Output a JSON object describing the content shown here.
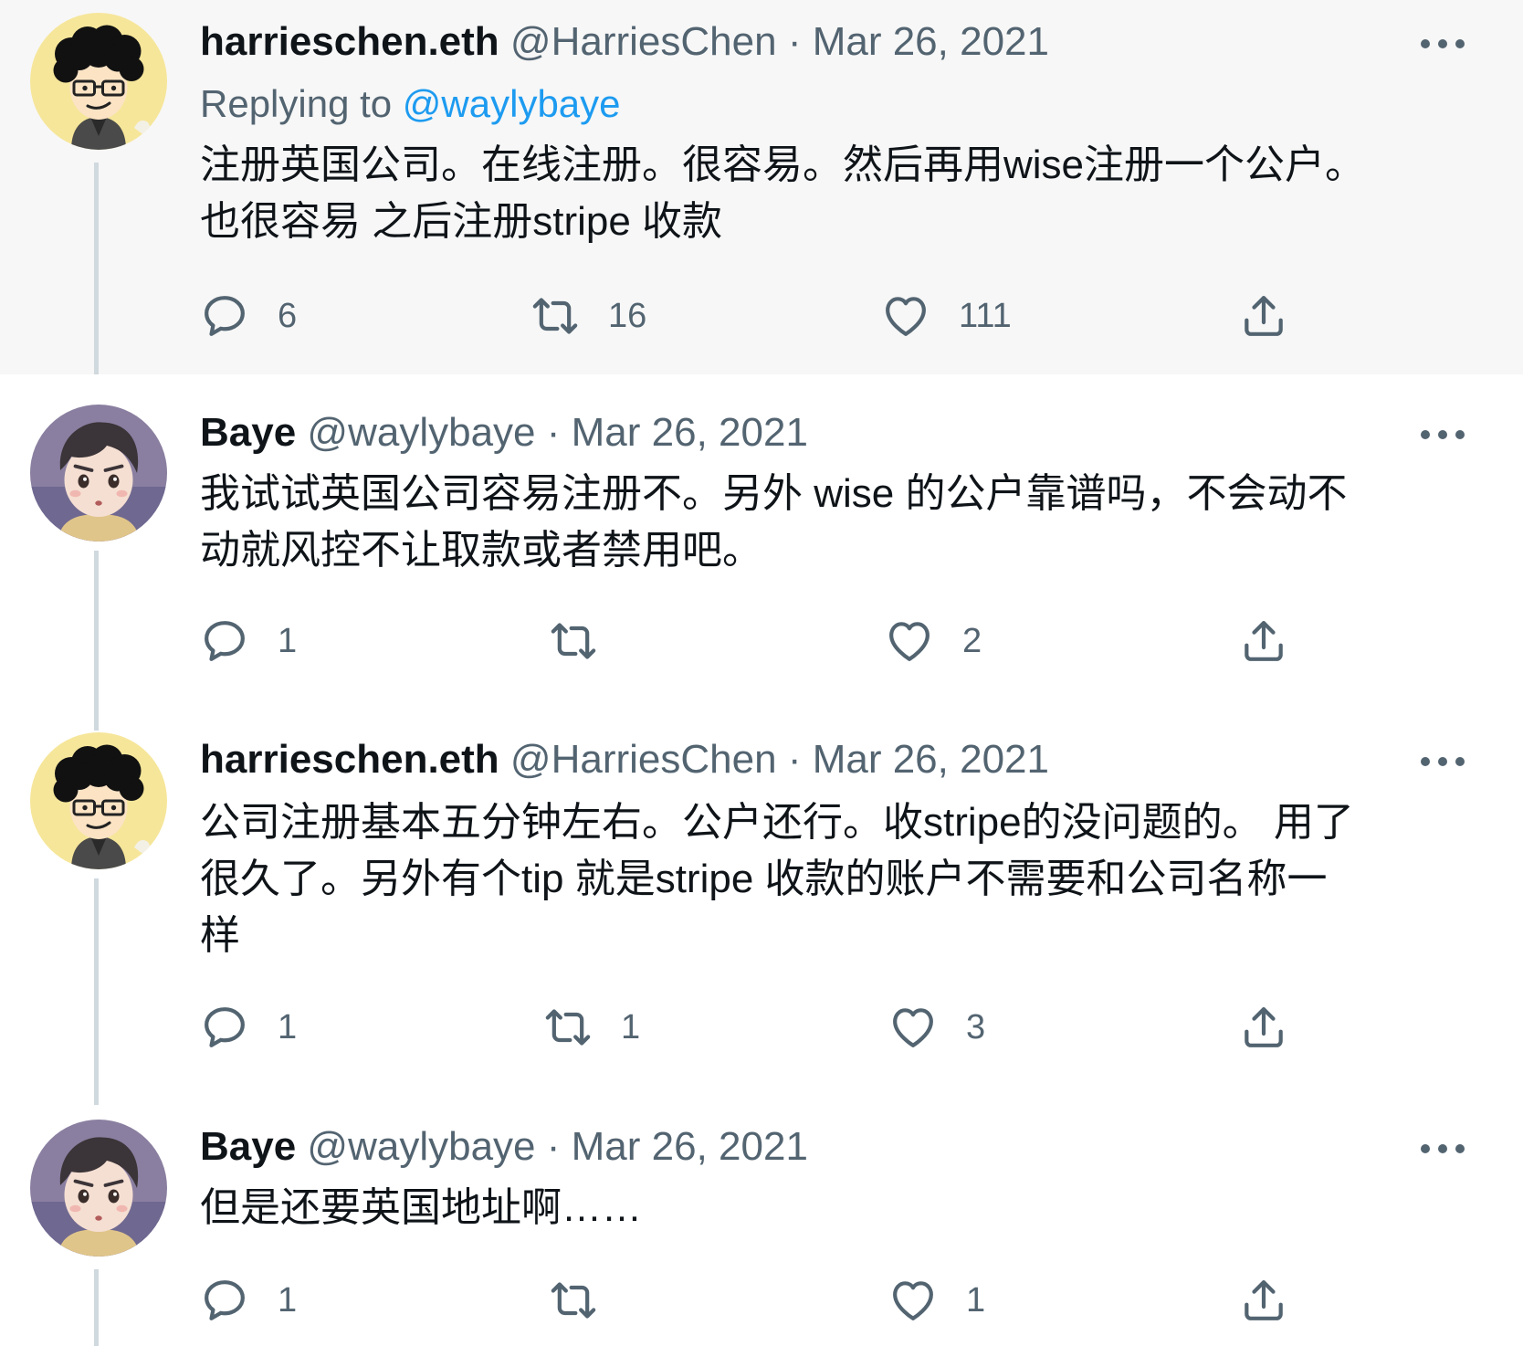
{
  "tweets": [
    {
      "display_name": "harrieschen.eth",
      "handle": "@HarriesChen",
      "separator": "·",
      "date": "Mar 26, 2021",
      "replying_label": "Replying to",
      "replying_to": "@waylybaye",
      "text": "注册英国公司。在线注册。很容易。然后再用wise注册一个公户。\n也很容易 之后注册stripe 收款",
      "reply_count": "6",
      "retweet_count": "16",
      "like_count": "111"
    },
    {
      "display_name": "Baye",
      "handle": "@waylybaye",
      "separator": "·",
      "date": "Mar 26, 2021",
      "text": "我试试英国公司容易注册不。另外 wise 的公户靠谱吗，不会动不\n动就风控不让取款或者禁用吧。",
      "reply_count": "1",
      "retweet_count": "",
      "like_count": "2"
    },
    {
      "display_name": "harrieschen.eth",
      "handle": "@HarriesChen",
      "separator": "·",
      "date": "Mar 26, 2021",
      "text": "公司注册基本五分钟左右。公户还行。收stripe的没问题的。 用了\n很久了。另外有个tip 就是stripe 收款的账户不需要和公司名称一\n样",
      "reply_count": "1",
      "retweet_count": "1",
      "like_count": "3"
    },
    {
      "display_name": "Baye",
      "handle": "@waylybaye",
      "separator": "·",
      "date": "Mar 26, 2021",
      "text": "但是还要英国地址啊……",
      "reply_count": "1",
      "retweet_count": "",
      "like_count": "1"
    }
  ],
  "icons": {
    "reply": "reply-bubble-icon",
    "retweet": "retweet-arrows-icon",
    "like": "heart-icon",
    "share": "share-upload-icon",
    "more": "more-dots-icon"
  },
  "colors": {
    "text": "#0f1419",
    "muted": "#536471",
    "link": "#1d9bf0",
    "thread_line": "#cfd9de",
    "highlight_bg": "#f7f7f7"
  }
}
